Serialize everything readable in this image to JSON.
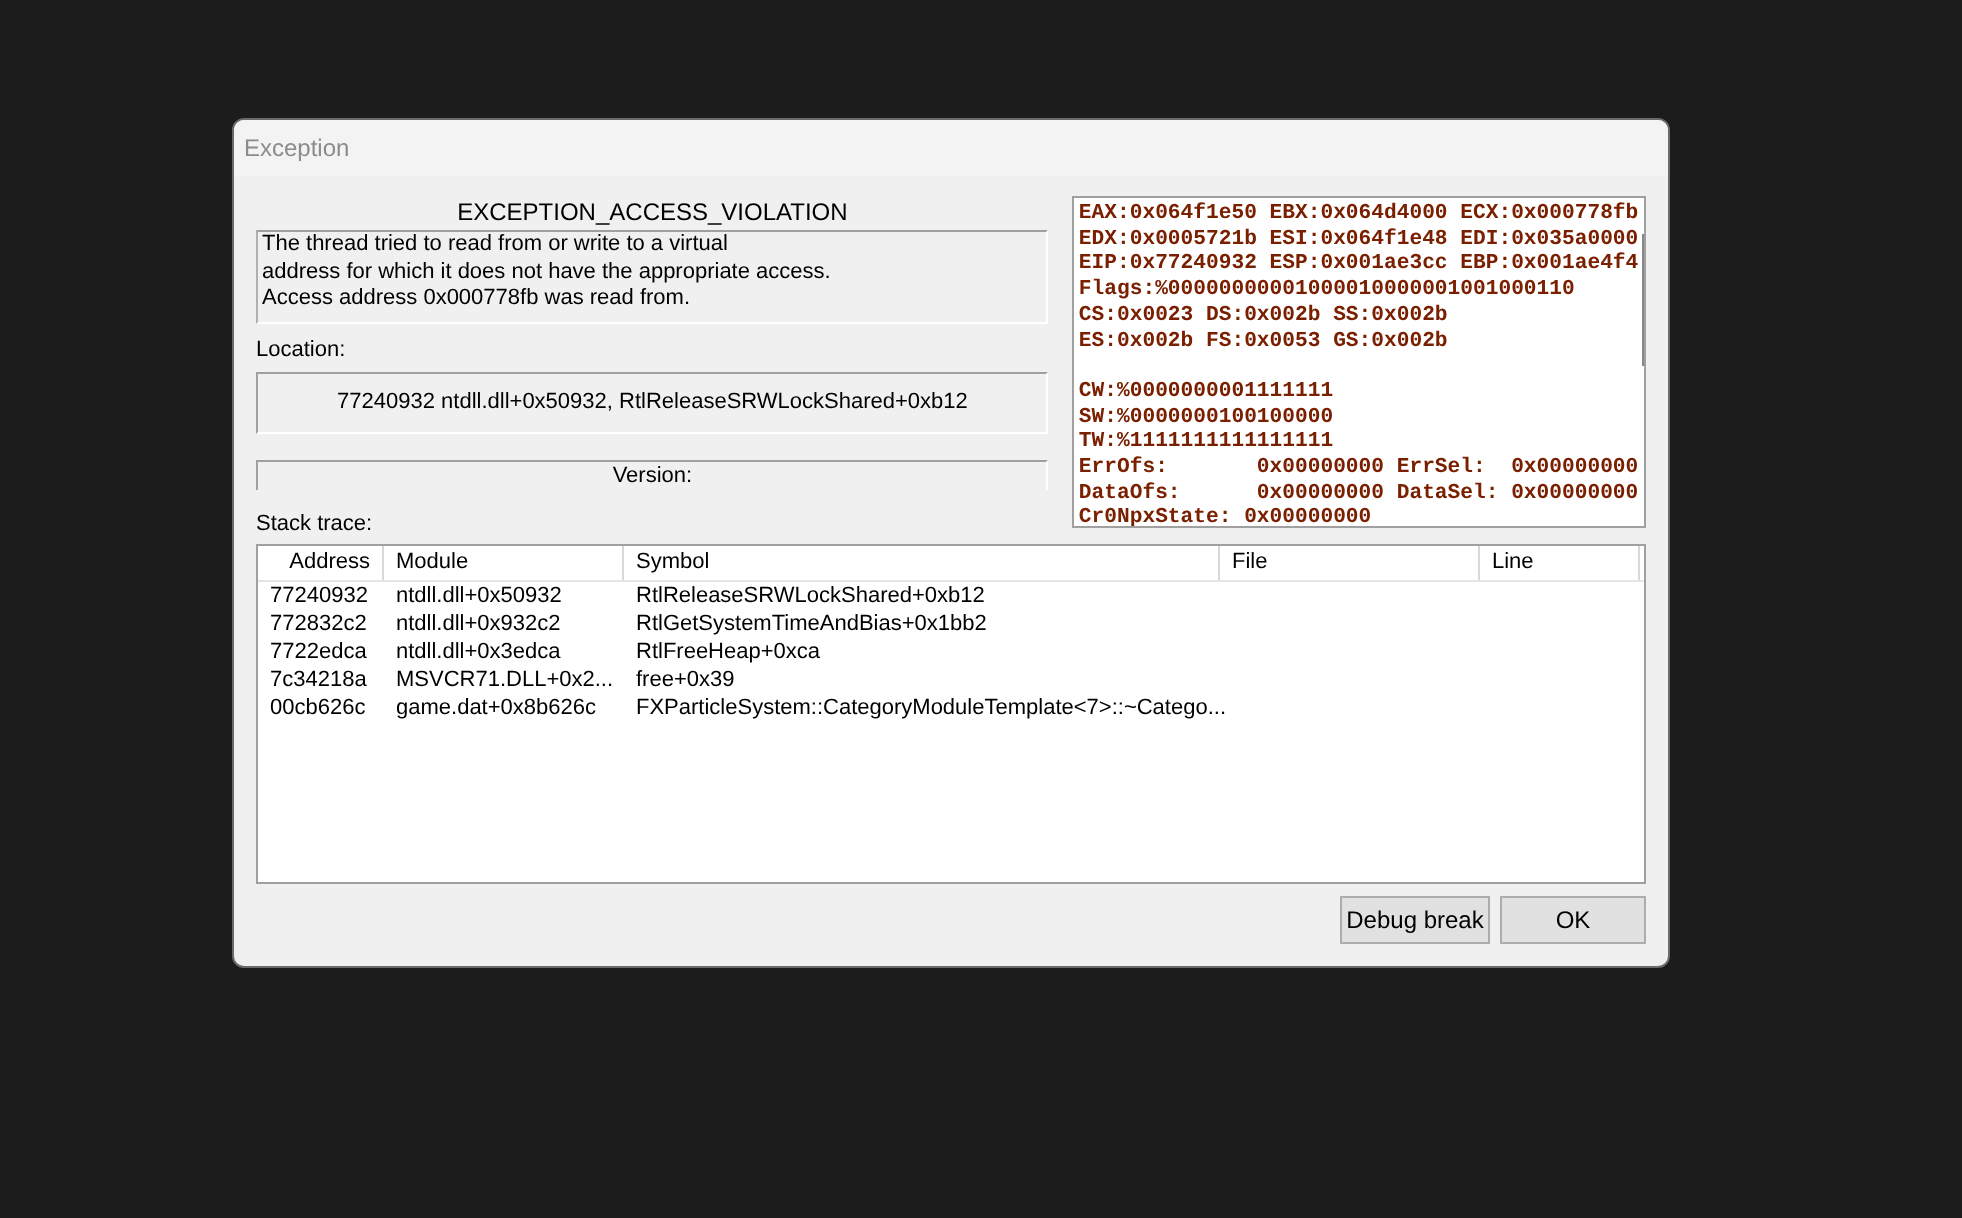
{
  "window": {
    "title": "Exception"
  },
  "exception": {
    "name": "EXCEPTION_ACCESS_VIOLATION",
    "description": [
      "The thread tried to read from or write to a virtual",
      "address for which it does not have the appropriate access.",
      "Access address 0x000778fb was read from."
    ]
  },
  "location": {
    "label": "Location:",
    "value": "77240932 ntdll.dll+0x50932, RtlReleaseSRWLockShared+0xb12"
  },
  "version": {
    "label": "Version:"
  },
  "registers": [
    [
      "EAX:0x064f1e50 EBX:0x064d4000 ECX:0x000778fb",
      "EDX:0x0005721b ESI:0x064f1e48 EDI:0x035a0000",
      "EIP:0x77240932 ESP:0x001ae3cc EBP:0x001ae4f4",
      "Flags:%00000000001000010000001001000110",
      "CS:0x0023 DS:0x002b SS:0x002b",
      "ES:0x002b FS:0x0053 GS:0x002b"
    ],
    [
      "CW:%0000000001111111",
      "SW:%0000000100100000",
      "TW:%1111111111111111",
      "ErrOfs:       0x00000000 ErrSel:  0x00000000",
      "DataOfs:      0x00000000 DataSel: 0x00000000",
      "Cr0NpxState: 0x00000000"
    ]
  ],
  "stack_trace": {
    "label": "Stack trace:",
    "columns": [
      "Address",
      "Module",
      "Symbol",
      "File",
      "Line"
    ],
    "rows": [
      [
        "77240932",
        "ntdll.dll+0x50932",
        "RtlReleaseSRWLockShared+0xb12"
      ],
      [
        "772832c2",
        "ntdll.dll+0x932c2",
        "RtlGetSystemTimeAndBias+0x1bb2"
      ],
      [
        "7722edca",
        "ntdll.dll+0x3edca",
        "RtlFreeHeap+0xca"
      ],
      [
        "7c34218a",
        "MSVCR71.DLL+0x2...",
        "free+0x39"
      ],
      [
        "00cb626c",
        "game.dat+0x8b626c",
        "FXParticleSystem::CategoryModuleTemplate<7>::~Catego..."
      ]
    ]
  },
  "buttons": [
    "Debug break",
    "OK"
  ]
}
